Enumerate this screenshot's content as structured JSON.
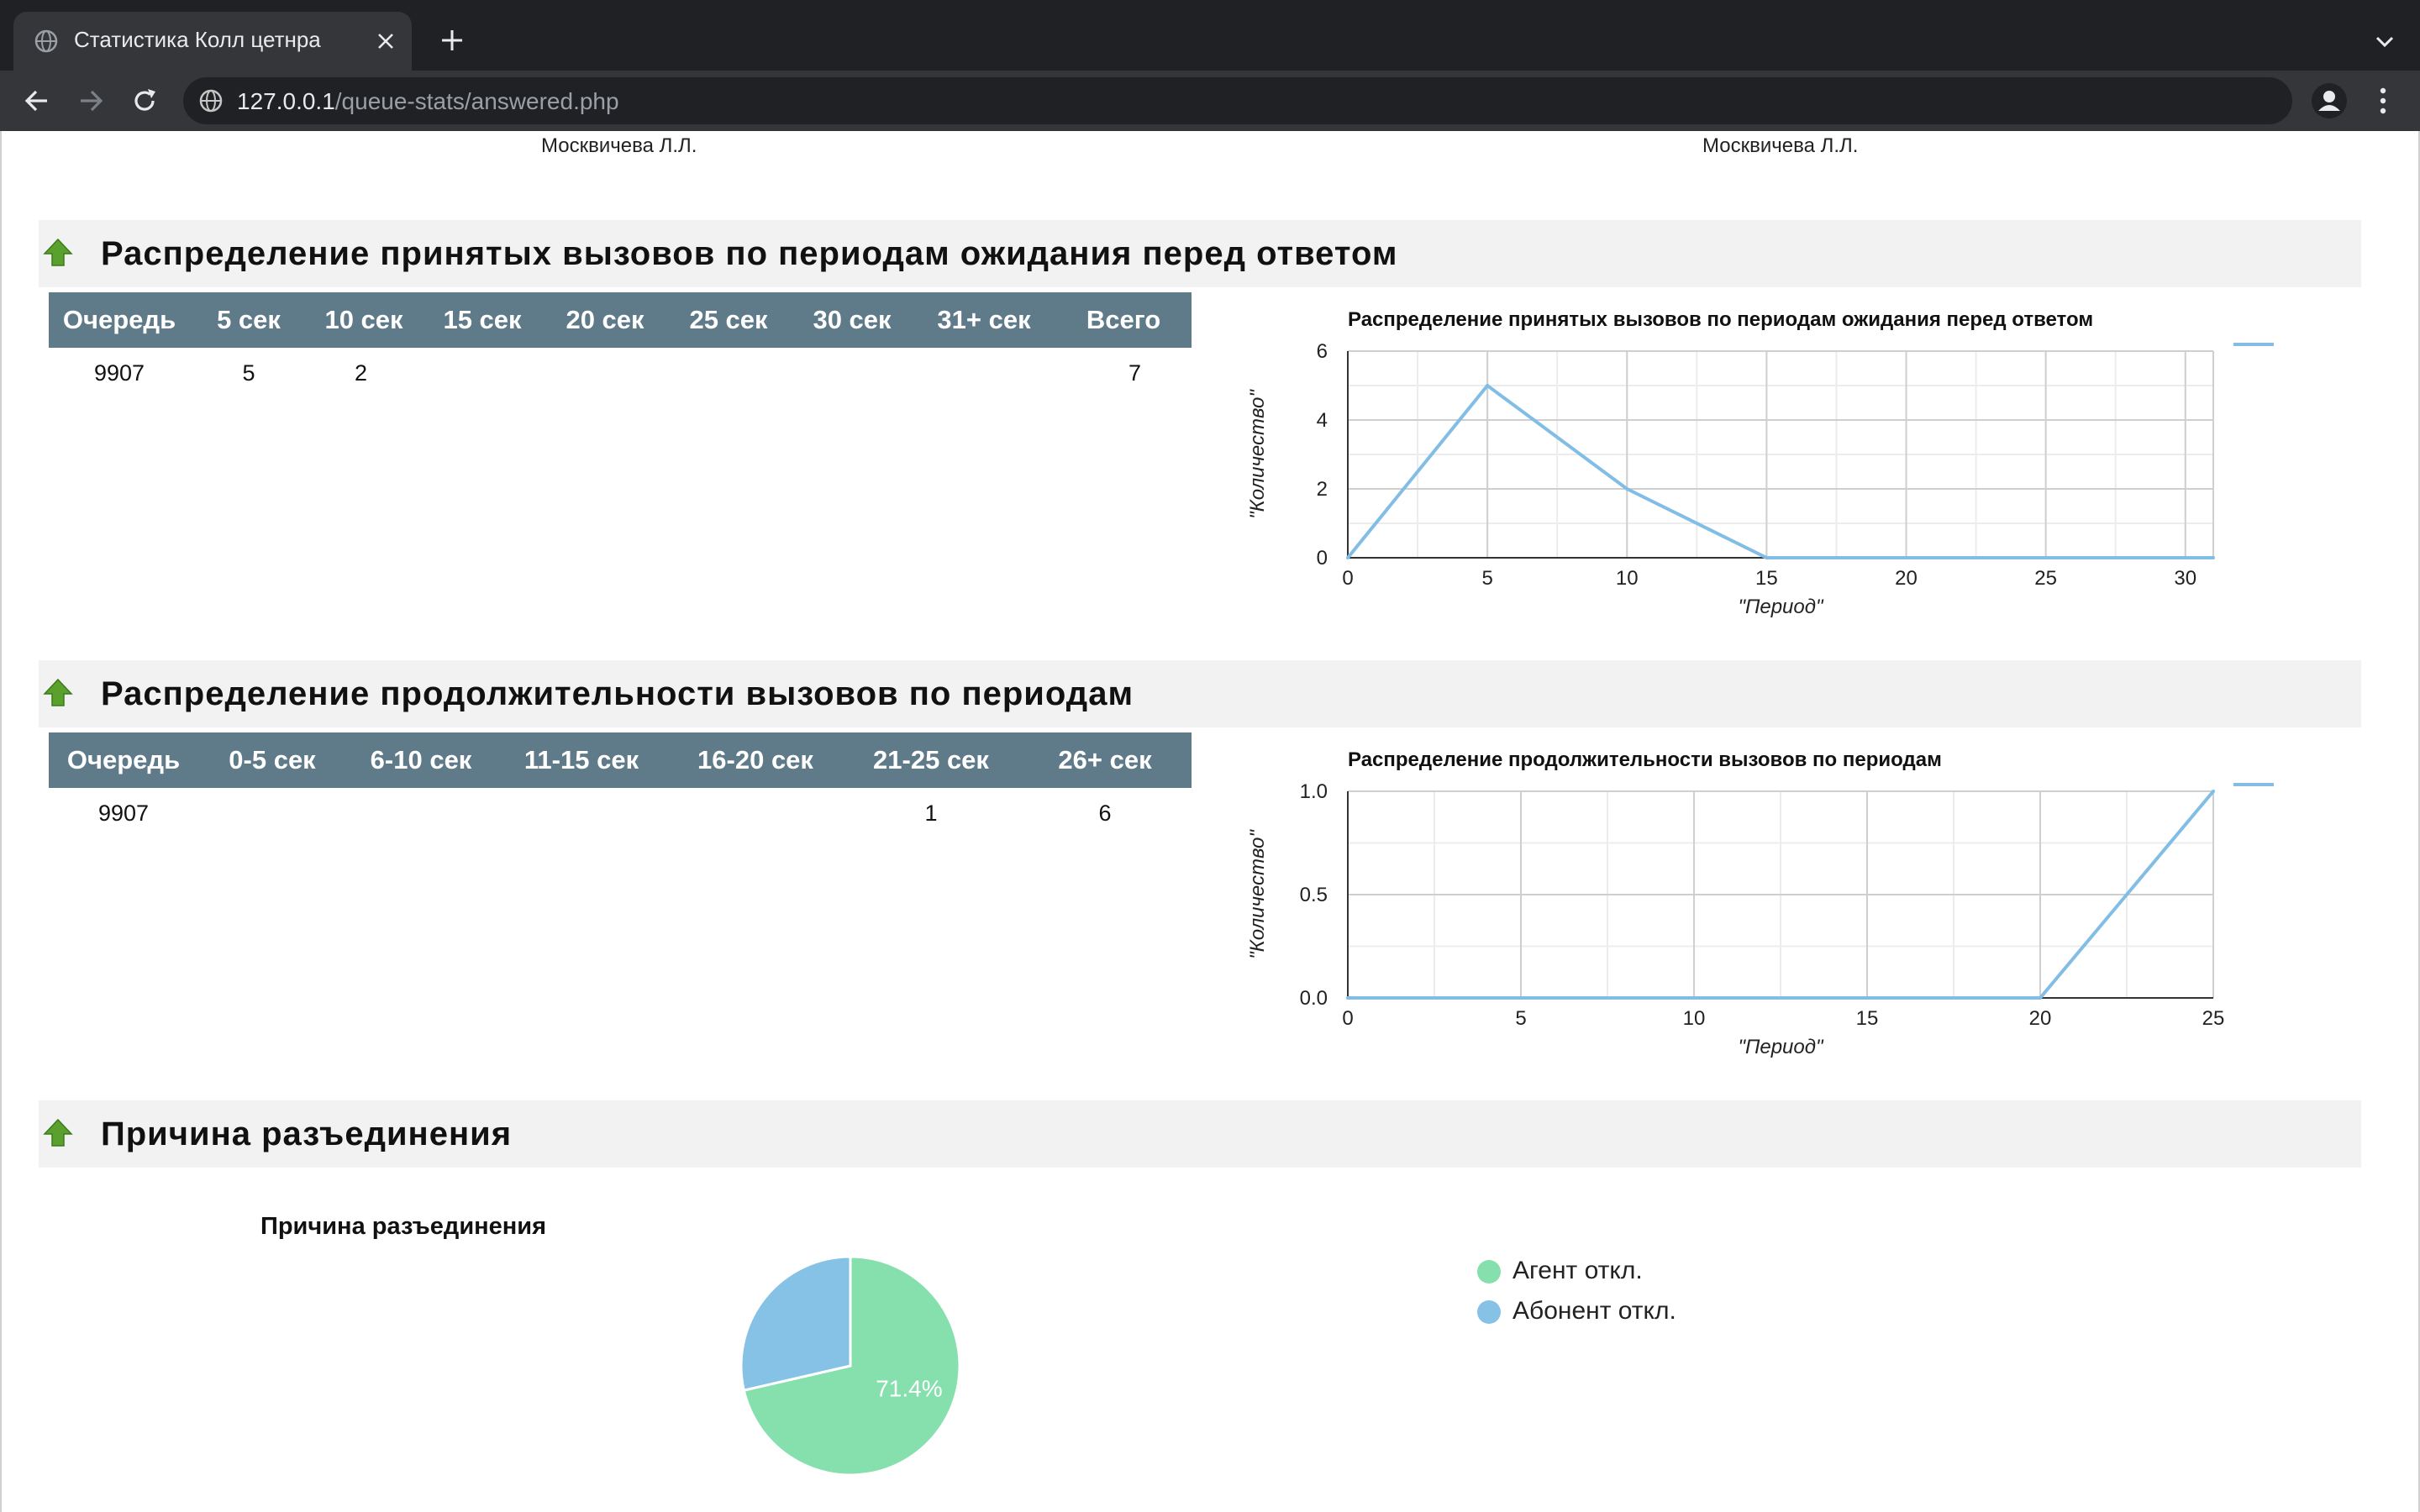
{
  "browser": {
    "tab_title": "Статистика Колл цетнра",
    "url_host": "127.0.0.1",
    "url_path": "/queue-stats/answered.php"
  },
  "agents_row": [
    "Москвичева Л.Л.",
    "Москвичева Л.Л."
  ],
  "section_wait": {
    "title": "Распределение принятых вызовов по периодам ожидания перед ответом",
    "table": {
      "headers": [
        "Очередь",
        "5 сек",
        "10 сек",
        "15 сек",
        "20 сек",
        "25 сек",
        "30 сек",
        "31+ сек",
        "Всего"
      ],
      "rows": [
        [
          "9907",
          "5",
          "2",
          "",
          "",
          "",
          "",
          "",
          "7"
        ]
      ]
    }
  },
  "section_duration": {
    "title": "Распределение продолжительности вызовов по периодам",
    "table": {
      "headers": [
        "Очередь",
        "0-5 сек",
        "6-10 сек",
        "11-15 сек",
        "16-20 сек",
        "21-25 сек",
        "26+ сек"
      ],
      "rows": [
        [
          "9907",
          "",
          "",
          "",
          "",
          "1",
          "6"
        ]
      ]
    }
  },
  "section_disconnect": {
    "title": "Причина разъединения"
  },
  "colors": {
    "header_bg": "#5f7a89",
    "line": "#82bde6",
    "pie_agent": "#86e0ad",
    "pie_subscriber": "#86c1e6",
    "up_arrow": "#5aa02c"
  },
  "chart_data": [
    {
      "type": "line",
      "title": "Распределение принятых вызовов по периодам ожидания перед ответом",
      "xlabel": "\"Период\"",
      "ylabel": "\"Количество\"",
      "x": [
        0,
        5,
        10,
        15,
        20,
        25,
        30,
        31
      ],
      "series": [
        {
          "values": [
            0,
            5,
            2,
            0,
            0,
            0,
            0,
            0
          ]
        }
      ],
      "xlim": [
        0,
        31
      ],
      "ylim": [
        0,
        6
      ],
      "xticks": [
        0,
        5,
        10,
        15,
        20,
        25,
        30
      ],
      "yticks": [
        0,
        2,
        4,
        6
      ],
      "ytick_labels": [
        "0",
        "2",
        "4",
        "6"
      ],
      "grid": true,
      "legend": "top-right"
    },
    {
      "type": "line",
      "title": "Распределение продолжительности вызовов по периодам",
      "xlabel": "\"Период\"",
      "ylabel": "\"Количество\"",
      "x": [
        0,
        5,
        10,
        15,
        20,
        25
      ],
      "series": [
        {
          "values": [
            0,
            0,
            0,
            0,
            0,
            1
          ]
        }
      ],
      "xlim": [
        0,
        25
      ],
      "ylim": [
        0,
        1
      ],
      "xticks": [
        0,
        5,
        10,
        15,
        20,
        25
      ],
      "yticks": [
        0,
        0.5,
        1
      ],
      "ytick_labels": [
        "0.0",
        "0.5",
        "1.0"
      ],
      "grid": true,
      "legend": "top-right"
    },
    {
      "type": "pie",
      "title": "Причина разъединения",
      "categories": [
        "Агент откл.",
        "Абонент откл."
      ],
      "values": [
        71.4,
        28.6
      ],
      "data_labels": [
        "71.4%"
      ],
      "legend": "right"
    }
  ]
}
